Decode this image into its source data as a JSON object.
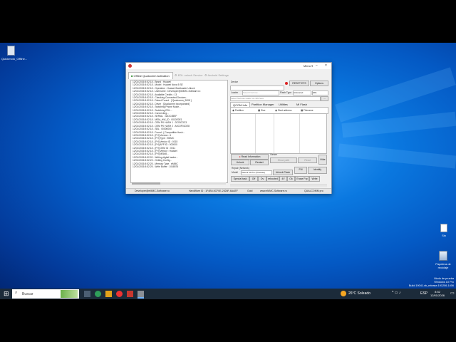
{
  "desktop": {
    "icons": [
      {
        "label": "Quickmoto_Offline..."
      },
      {
        "label": "Sin"
      },
      {
        "label": "Papelera de reciclaje"
      }
    ],
    "watermark": {
      "line1": "Modo de prueba",
      "line2": "Windows 10 Pro",
      "line3": "Build 19041.vb_release.191206-1406"
    }
  },
  "window": {
    "title_menu": "Menu ▾",
    "tabs": [
      "Offline Qualcomm Activation",
      "EDL unlock Service",
      "Android Settings"
    ],
    "log_lines": [
      "12/01/2026 8:52:18 - Brand : Huawei",
      "12/01/2026 8:52:18 - Model : Huawei Nova 5 SE",
      "12/01/2026 8:52:18 - Operation : Huawei Bootloader Unlock",
      "12/01/2026 8:52:18 - Username : Developer@eMMC-Software.ru",
      "12/01/2026 8:52:18 - Available Credits : 13",
      "12/01/2026 8:52:18 - Checking Connected Devices...",
      "12/01/2026 8:52:18 - Detect Found : [ Qualcomm_9008 ]",
      "12/01/2026 8:52:18 - Driver : [Qualcomm Incorporated]",
      "12/01/2026 8:52:18 - Switching Phone Mode...",
      "12/01/2026 8:52:18 - Switching EDL...",
      "12/01/2026 8:52:18 - Connecting...",
      "12/01/2026 8:52:18 - SERIAL : 32DC4BEF",
      "12/01/2026 8:52:18 - MSM_HW_ID : 0010E0E1",
      "12/01/2026 8:52:18 - OEM PK HASH 1 : 3C03C3C3",
      "12/01/2026 8:52:18 - OEM PK HASH 2 : A0C0F01DE8",
      "12/01/2026 8:52:18 - SBL : 00000000",
      "12/01/2026 8:52:18 - Found : [ Compatible Hash...",
      "12/01/2026 8:52:18 - [FH] Version : 6",
      "12/01/2026 8:52:18 - [FH] Type : EMMC",
      "12/01/2026 8:52:18 - [FH] Vendor ID : 0015",
      "12/01/2026 8:52:18 - [FH] APP ID : 000000",
      "12/01/2026 8:52:18 - [FH] OEM ID : 0011",
      "12/01/2026 8:52:18 - [FH] Vendor : Huawei",
      "12/01/2026 8:52:18 - [FH] MSM8...",
      "12/01/2026 8:52:20 - Writing digital loader...",
      "12/01/2026 8:52:23 - Getting Config...",
      "12/01/2026 8:52:25 - Memory Type : eMMC",
      "12/01/2026 8:52:25 - Write Buffer : 1048576"
    ],
    "right": {
      "device_label": "Device",
      "reset_btn": "RESET EFS",
      "options_btn": "Options",
      "loader_label": "Loader",
      "loader_value": "Select Firehose...",
      "flash_type_label": "Flash Type",
      "flash_type_value": "Advanced",
      "edl_value": "EDL",
      "path_placeholder": "Select firehose loader or click here",
      "subtabs": [
        "QCOM Info",
        "Partition Manager",
        "Utilities",
        "Mi Flash"
      ],
      "grid_headers": [
        "Partition",
        "Size",
        "Start address",
        "Filename"
      ],
      "read_info_btn": "Read Information",
      "unlock_btn": "Unlock",
      "restart_btn": "Restart",
      "viewer_label": "Viewer",
      "show_path": "Show path",
      "read_button": "Read",
      "hide_btn": "Hide",
      "unlock_flash_btn": "Unlock Flash",
      "repair_label": "Repair (Network)",
      "model_label": "Model",
      "model_value": "Xiaomi 10 Pro (Tiramisu)",
      "btn_row": [
        "Special task",
        "Off",
        "Ov",
        "rebooted",
        "4V",
        "Ok",
        "Erase Frp",
        "Write"
      ],
      "fm_label": "FM",
      "identify_label": "Identify"
    },
    "status_bar": {
      "user": "Developer@eMMC-Software.ru",
      "hw_id": "HardWare ID : 1F4B0-5CF0E-2528F-6AAEF",
      "tier": "Gold",
      "site": "www.eMMC-Software.ru",
      "brand": "QUALCOMM pro"
    }
  },
  "taskbar": {
    "search_placeholder": "Buscar",
    "weather": "26°C  Soleado",
    "lang": "ESP",
    "time": "8:52",
    "date": "12/01/2026"
  }
}
